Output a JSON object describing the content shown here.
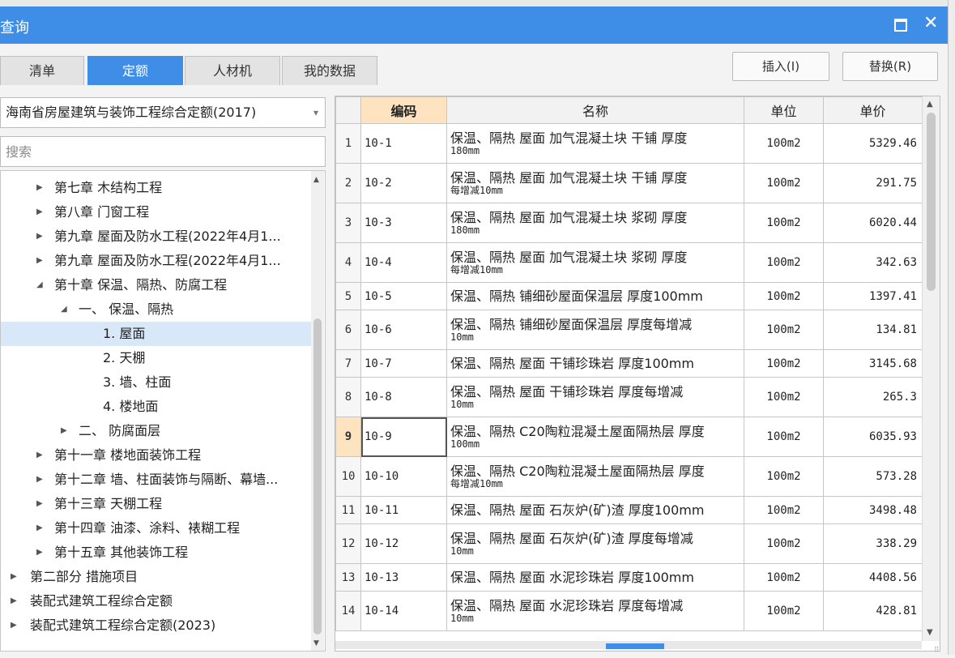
{
  "dialog": {
    "title": "查询"
  },
  "tabs": [
    {
      "label": "清单"
    },
    {
      "label": "定额"
    },
    {
      "label": "人材机"
    },
    {
      "label": "我的数据"
    }
  ],
  "actions": {
    "insert": "插入(I)",
    "replace": "替换(R)"
  },
  "quota_select": {
    "value": "海南省房屋建筑与装饰工程综合定额(2017)"
  },
  "search": {
    "placeholder": "搜索"
  },
  "tree": [
    {
      "label": "第七章 木结构工程",
      "expanded": false
    },
    {
      "label": "第八章 门窗工程",
      "expanded": false
    },
    {
      "label": "第九章 屋面及防水工程(2022年4月1...",
      "expanded": false
    },
    {
      "label": "第九章 屋面及防水工程(2022年4月1...",
      "expanded": false
    },
    {
      "label": "第十章 保温、隔热、防腐工程",
      "expanded": true
    },
    {
      "label": "一、 保温、隔热",
      "expanded": true
    },
    {
      "label": "1. 屋面",
      "selected": true
    },
    {
      "label": "2. 天棚"
    },
    {
      "label": "3. 墙、柱面"
    },
    {
      "label": "4. 楼地面"
    },
    {
      "label": "二、 防腐面层",
      "expanded": false
    },
    {
      "label": "第十一章 楼地面装饰工程",
      "expanded": false
    },
    {
      "label": "第十二章 墙、柱面装饰与隔断、幕墙...",
      "expanded": false
    },
    {
      "label": "第十三章 天棚工程",
      "expanded": false
    },
    {
      "label": "第十四章 油漆、涂料、裱糊工程",
      "expanded": false
    },
    {
      "label": "第十五章 其他装饰工程",
      "expanded": false
    },
    {
      "label": "第二部分 措施项目",
      "expanded": false
    },
    {
      "label": "装配式建筑工程综合定额",
      "expanded": false
    },
    {
      "label": "装配式建筑工程综合定额(2023)",
      "expanded": false
    }
  ],
  "table": {
    "columns": [
      "编码",
      "名称",
      "单位",
      "单价"
    ],
    "rows": [
      {
        "no": "1",
        "code": "10-1",
        "name": "保温、隔热 屋面 加气混凝土块 干铺 厚度",
        "name2": "180mm",
        "unit": "100m2",
        "price": "5329.46"
      },
      {
        "no": "2",
        "code": "10-2",
        "name": "保温、隔热 屋面 加气混凝土块 干铺 厚度",
        "name2": "每增减10mm",
        "unit": "100m2",
        "price": "291.75"
      },
      {
        "no": "3",
        "code": "10-3",
        "name": "保温、隔热 屋面 加气混凝土块 浆砌 厚度",
        "name2": "180mm",
        "unit": "100m2",
        "price": "6020.44"
      },
      {
        "no": "4",
        "code": "10-4",
        "name": "保温、隔热 屋面 加气混凝土块 浆砌 厚度",
        "name2": "每增减10mm",
        "unit": "100m2",
        "price": "342.63"
      },
      {
        "no": "5",
        "code": "10-5",
        "name": "保温、隔热 铺细砂屋面保温层 厚度100mm",
        "name2": "",
        "unit": "100m2",
        "price": "1397.41"
      },
      {
        "no": "6",
        "code": "10-6",
        "name": "保温、隔热 铺细砂屋面保温层 厚度每增减",
        "name2": "10mm",
        "unit": "100m2",
        "price": "134.81"
      },
      {
        "no": "7",
        "code": "10-7",
        "name": "保温、隔热 屋面 干铺珍珠岩 厚度100mm",
        "name2": "",
        "unit": "100m2",
        "price": "3145.68"
      },
      {
        "no": "8",
        "code": "10-8",
        "name": "保温、隔热 屋面 干铺珍珠岩 厚度每增减",
        "name2": "10mm",
        "unit": "100m2",
        "price": "265.3"
      },
      {
        "no": "9",
        "code": "10-9",
        "name": "保温、隔热 C20陶粒混凝土屋面隔热层 厚度",
        "name2": "100mm",
        "unit": "100m2",
        "price": "6035.93",
        "current": true
      },
      {
        "no": "10",
        "code": "10-10",
        "name": "保温、隔热 C20陶粒混凝土屋面隔热层 厚度",
        "name2": "每增减10mm",
        "unit": "100m2",
        "price": "573.28"
      },
      {
        "no": "11",
        "code": "10-11",
        "name": "保温、隔热 屋面 石灰炉(矿)渣 厚度100mm",
        "name2": "",
        "unit": "100m2",
        "price": "3498.48"
      },
      {
        "no": "12",
        "code": "10-12",
        "name": "保温、隔热 屋面 石灰炉(矿)渣 厚度每增减",
        "name2": "10mm",
        "unit": "100m2",
        "price": "338.29"
      },
      {
        "no": "13",
        "code": "10-13",
        "name": "保温、隔热 屋面 水泥珍珠岩 厚度100mm",
        "name2": "",
        "unit": "100m2",
        "price": "4408.56"
      },
      {
        "no": "14",
        "code": "10-14",
        "name": "保温、隔热 屋面 水泥珍珠岩 厚度每增减",
        "name2": "10mm",
        "unit": "100m2",
        "price": "428.81"
      }
    ]
  }
}
